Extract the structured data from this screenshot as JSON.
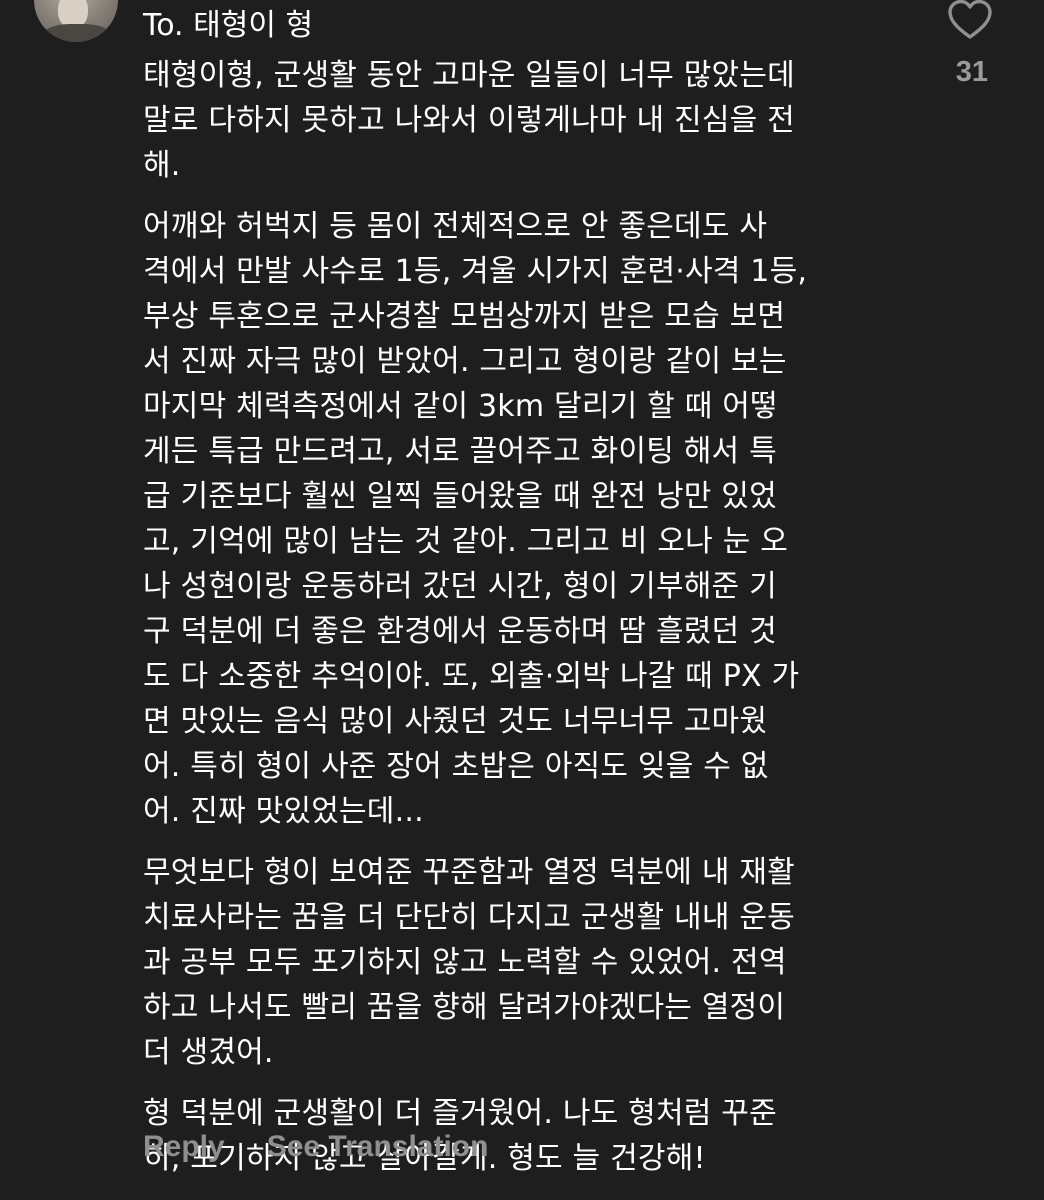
{
  "comment": {
    "title": "To. 태형이 형",
    "likes": "31",
    "paragraphs": [
      "태형이형, 군생활 동안 고마운 일들이 너무 많았는데\n말로 다하지 못하고 나와서 이렇게나마 내 진심을 전\n해.",
      " 어깨와 허벅지 등 몸이 전체적으로 안 좋은데도 사\n격에서 만발 사수로 1등, 겨울 시가지 훈련·사격 1등,\n부상 투혼으로 군사경찰 모범상까지 받은 모습 보면\n서 진짜 자극 많이 받았어. 그리고 형이랑 같이 보는\n마지막 체력측정에서 같이 3km 달리기 할 때 어떻\n게든 특급 만드려고, 서로 끌어주고 화이팅 해서 특\n급 기준보다 훨씬 일찍 들어왔을 때 완전 낭만 있었\n고, 기억에 많이 남는 것 같아. 그리고 비 오나 눈 오\n나 성현이랑 운동하러 갔던 시간, 형이 기부해준 기\n구 덕분에 더 좋은 환경에서 운동하며 땀 흘렸던 것\n도 다 소중한 추억이야. 또, 외출·외박 나갈 때 PX 가\n면 맛있는 음식 많이 사줬던 것도 너무너무 고마웠\n어. 특히 형이 사준 장어 초밥은 아직도 잊을 수 없\n어. 진짜 맛있었는데...",
      "무엇보다 형이 보여준 꾸준함과 열정 덕분에 내 재활\n치료사라는 꿈을 더 단단히 다지고 군생활 내내 운동\n과 공부 모두 포기하지 않고 노력할 수 있었어. 전역\n하고 나서도 빨리 꿈을 향해 달려가야겠다는 열정이\n더 생겼어.",
      "형 덕분에 군생활이 더 즐거웠어. 나도 형처럼 꾸준\n히, 포기하지 않고 살아갈게. 형도 늘 건강해!"
    ]
  },
  "actions": {
    "reply": "Reply",
    "translate": "See Translation"
  },
  "icons": {
    "like": "heart-outline-icon"
  },
  "colors": {
    "background": "#1e1e1e",
    "text": "#ffffff",
    "muted": "#8f8f8f"
  }
}
